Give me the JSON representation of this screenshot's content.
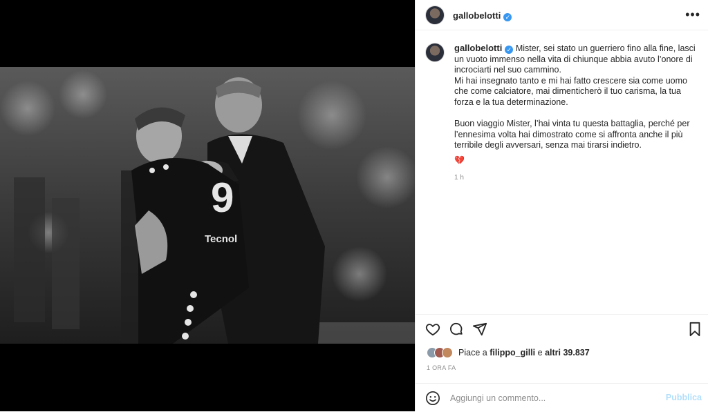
{
  "post": {
    "username": "gallobelotti",
    "verified_icon": "verified-badge-icon",
    "caption_lines": [
      "Mister, sei stato un guerriero fino alla fine, lasci un vuoto immenso nella vita di chiunque abbia avuto l’onore di incrociarti nel suo cammino.",
      "Mi hai insegnato tanto e mi hai fatto crescere sia come uomo che come calciatore, mai dimenticherò il tuo carisma, la tua forza e la tua determinazione.",
      "Buon viaggio Mister, l’hai vinta tu questa battaglia, perché per l’ennesima volta hai dimostrato come si affronta anche il più terribile degli avversari, senza mai tirarsi indietro.",
      "💔"
    ],
    "caption_age": "1 h",
    "likes_prefix": "Piace a",
    "likes_user": "filippo_gilli",
    "likes_conj": "e",
    "likes_others": "altri 39.837",
    "timestamp": "1 ORA FA",
    "add_comment_placeholder": "Aggiungi un commento...",
    "publish_label": "Pubblica",
    "colors": {
      "accent": "#3897f0",
      "publish_disabled": "#b2dffc",
      "text": "#262626",
      "muted": "#8e8e8e"
    }
  }
}
